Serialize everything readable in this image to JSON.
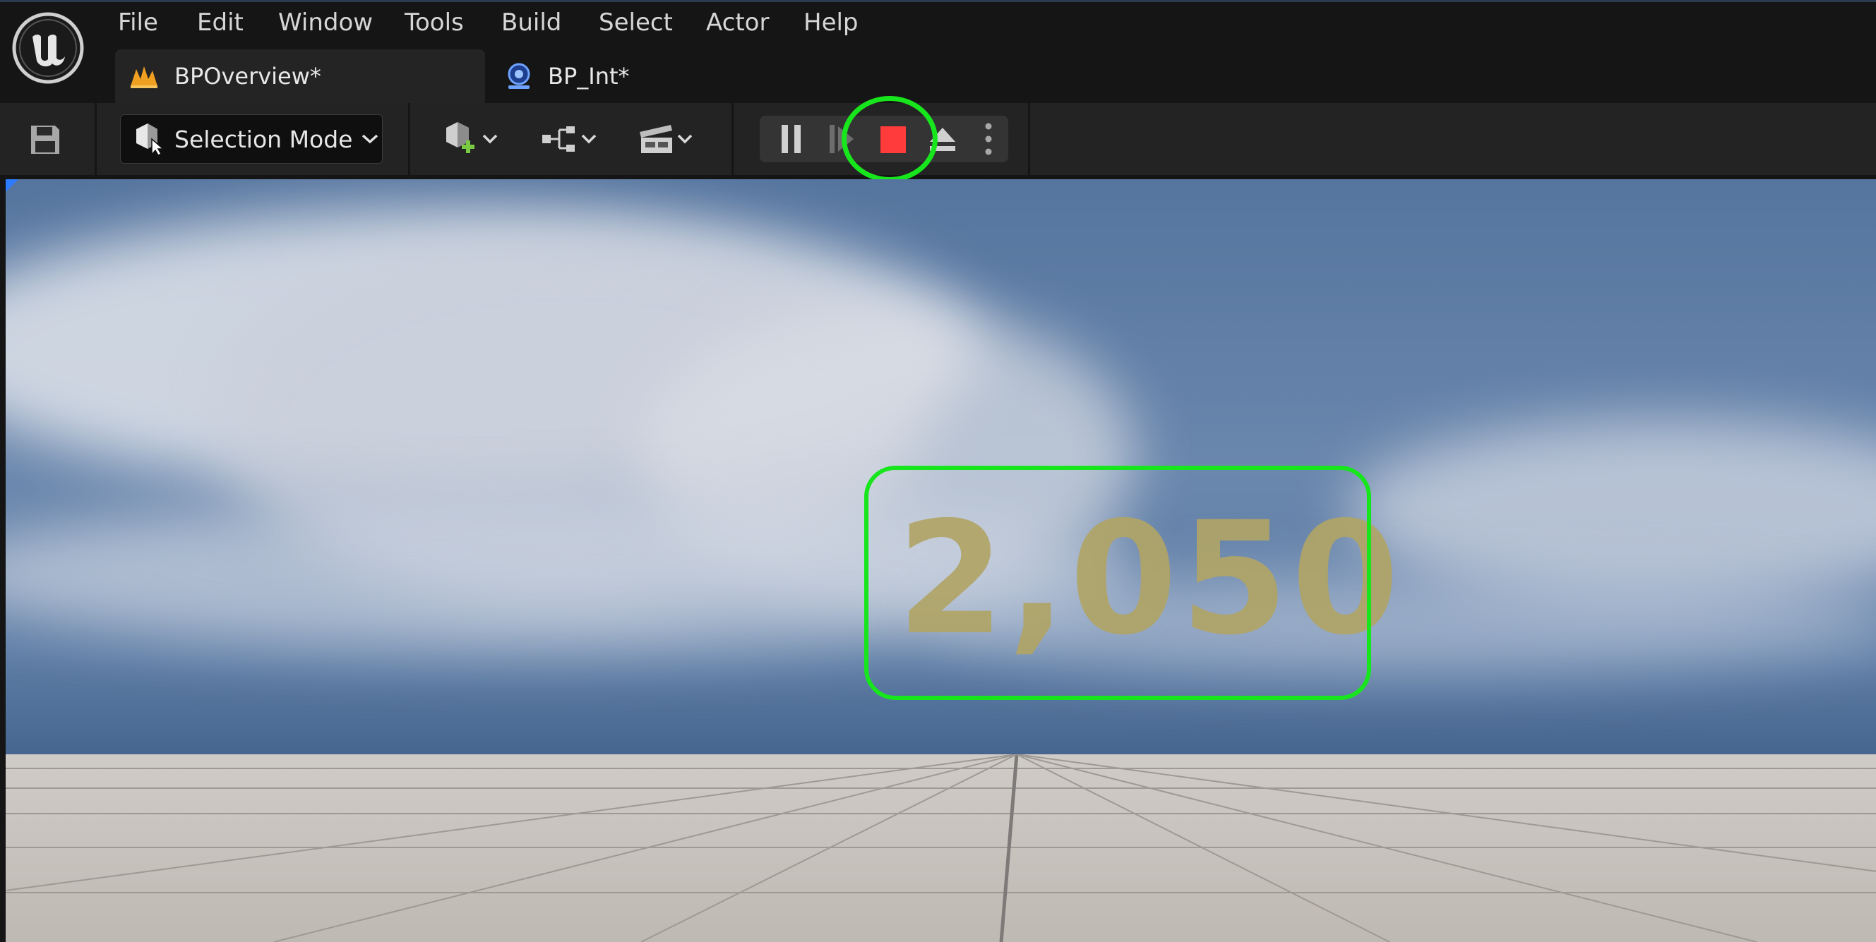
{
  "menu": {
    "file": "File",
    "edit": "Edit",
    "window": "Window",
    "tools": "Tools",
    "build": "Build",
    "select": "Select",
    "actor": "Actor",
    "help": "Help"
  },
  "tabs": [
    {
      "label": "BPOverview*",
      "icon": "level-icon",
      "active": true
    },
    {
      "label": "BP_Int*",
      "icon": "blueprint-icon",
      "active": false
    }
  ],
  "toolbar": {
    "selection_mode_label": "Selection Mode",
    "icons": [
      "save-icon",
      "add-actor-icon",
      "blueprints-icon",
      "cinematics-icon",
      "pause-icon",
      "step-frame-icon",
      "stop-icon",
      "eject-icon",
      "more-options-icon"
    ]
  },
  "viewport": {
    "score_text": "2,050"
  },
  "colors": {
    "highlight": "#18e61d",
    "stop_button": "#ff3b3b",
    "score_text": "#b0a466",
    "level_icon": "#f0a020"
  }
}
